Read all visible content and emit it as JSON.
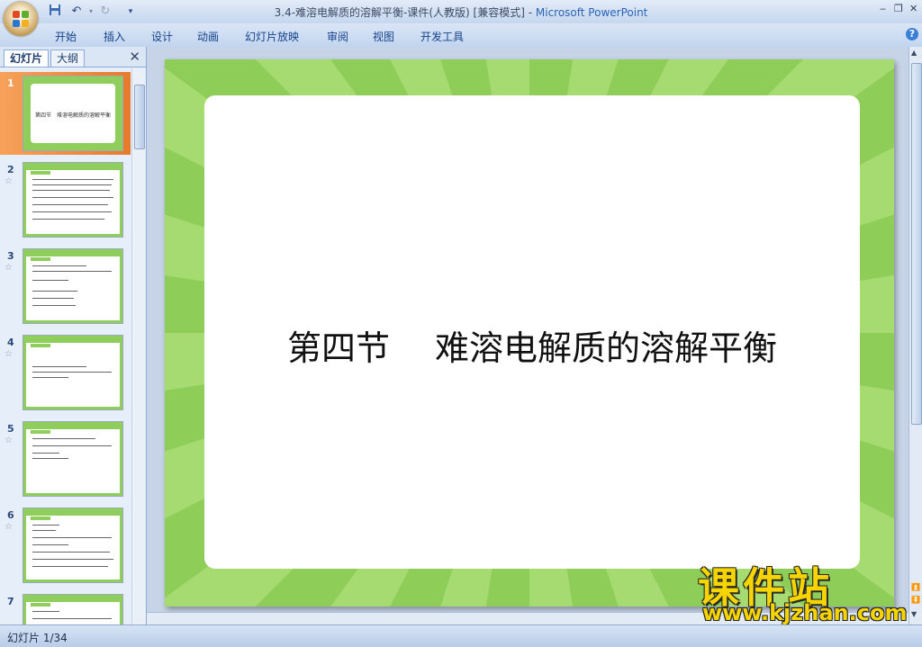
{
  "window": {
    "title_doc": "3.4-难溶电解质的溶解平衡-课件(人教版) [兼容模式] - ",
    "title_app": "Microsoft PowerPoint"
  },
  "quick_access": {
    "save_icon": "save-icon",
    "undo_icon": "undo-icon",
    "redo_icon": "redo-icon",
    "customize_icon": "dropdown-icon"
  },
  "ribbon": {
    "tabs": [
      "开始",
      "插入",
      "设计",
      "动画",
      "幻灯片放映",
      "审阅",
      "视图",
      "开发工具"
    ]
  },
  "left_pane": {
    "tabs": [
      "幻灯片",
      "大纲"
    ],
    "close_label": "✕",
    "thumbnails": [
      {
        "number": "1",
        "title": "第四节　难溶电解质的溶解平衡",
        "animated": false
      },
      {
        "number": "2",
        "animated": true
      },
      {
        "number": "3",
        "animated": true
      },
      {
        "number": "4",
        "animated": true
      },
      {
        "number": "5",
        "animated": true
      },
      {
        "number": "6",
        "animated": true
      },
      {
        "number": "7",
        "animated": true
      }
    ]
  },
  "slide": {
    "title": "第四节　 难溶电解质的溶解平衡",
    "background_colors": [
      "#8fcd59",
      "#a6db72"
    ]
  },
  "watermark": {
    "main": "课件站",
    "url": "www.kjzhan.com"
  },
  "status": {
    "slide_counter": "幻灯片 1/34"
  }
}
